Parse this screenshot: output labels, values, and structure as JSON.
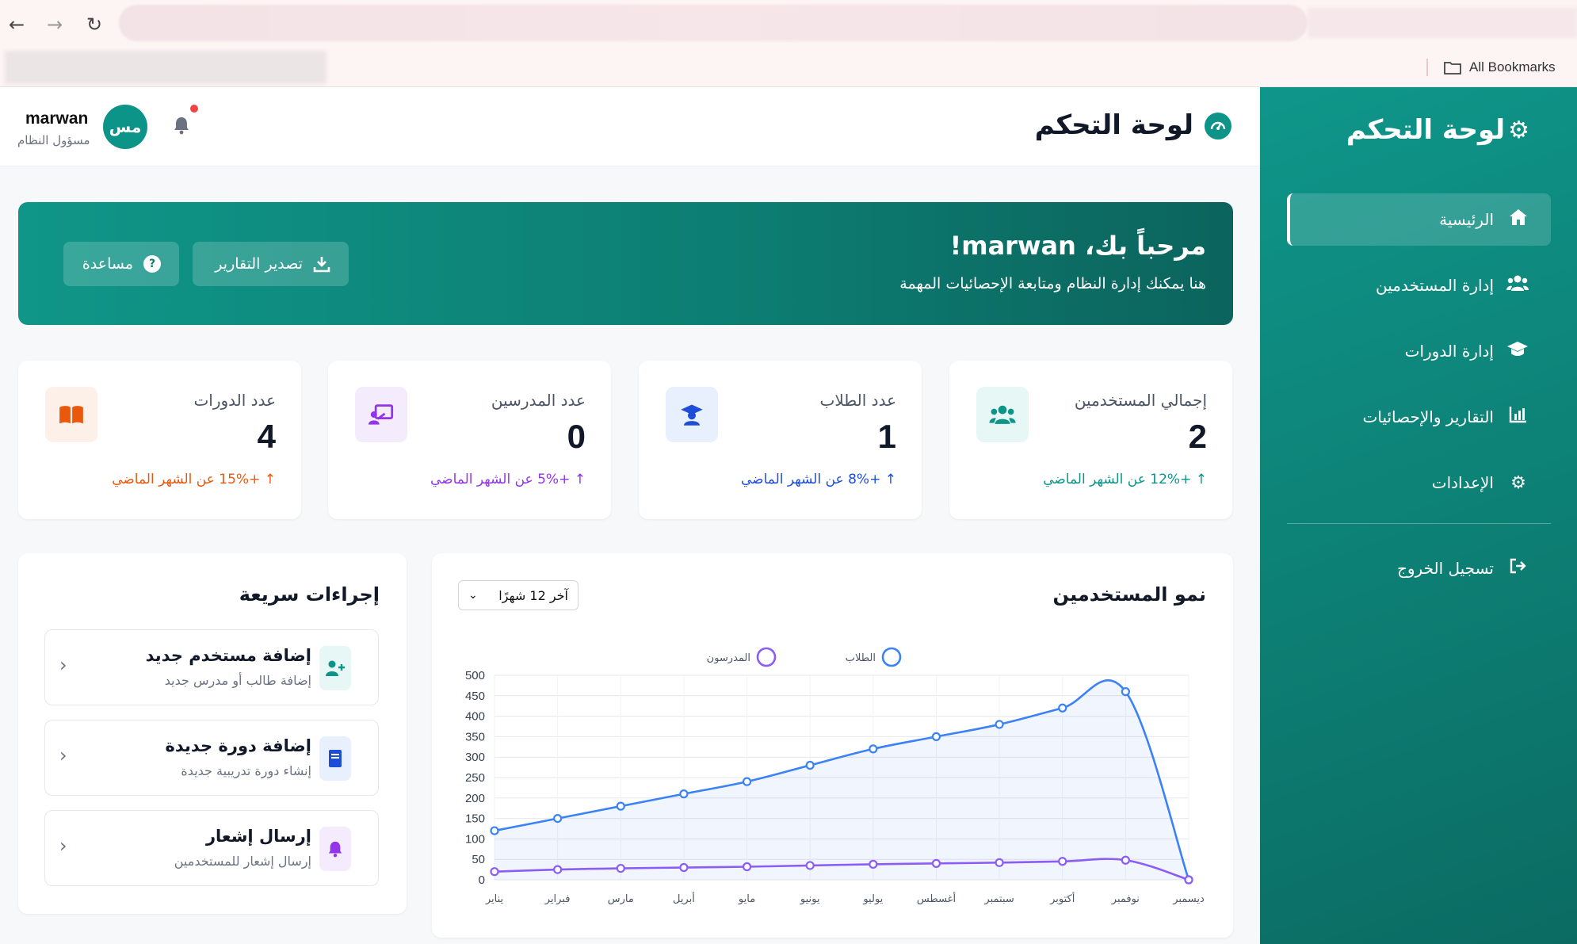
{
  "browser": {
    "bookmarks_label": "All Bookmarks"
  },
  "sidebar": {
    "brand": "لوحة التحكم",
    "items": [
      {
        "label": "الرئيسية",
        "icon": "home-icon",
        "active": true
      },
      {
        "label": "إدارة المستخدمين",
        "icon": "users-icon",
        "active": false
      },
      {
        "label": "إدارة الدورات",
        "icon": "graduation-cap-icon",
        "active": false
      },
      {
        "label": "التقارير والإحصائيات",
        "icon": "chart-icon",
        "active": false
      },
      {
        "label": "الإعدادات",
        "icon": "gear-icon",
        "active": false
      }
    ],
    "logout_label": "تسجيل الخروج"
  },
  "header": {
    "title": "لوحة التحكم",
    "user_name": "marwan",
    "user_role": "مسؤول النظام",
    "avatar_initials": "مس"
  },
  "banner": {
    "title": "مرحباً بك، marwan!",
    "subtitle": "هنا يمكنك إدارة النظام ومتابعة الإحصائيات المهمة",
    "export_label": "تصدير التقارير",
    "help_label": "مساعدة"
  },
  "stats": [
    {
      "label": "إجمالي المستخدمين",
      "value": "2",
      "trend": "↑ +12% عن الشهر الماضي",
      "color": "#0d9488",
      "bg": "#e6f7f5",
      "icon": "users-icon"
    },
    {
      "label": "عدد الطلاب",
      "value": "1",
      "trend": "↑ +8% عن الشهر الماضي",
      "color": "#1d4ed8",
      "bg": "#e8effd",
      "icon": "student-icon"
    },
    {
      "label": "عدد المدرسين",
      "value": "0",
      "trend": "↑ +5% عن الشهر الماضي",
      "color": "#9333ea",
      "bg": "#f4ebfd",
      "icon": "teacher-icon"
    },
    {
      "label": "عدد الدورات",
      "value": "4",
      "trend": "↑ +15% عن الشهر الماضي",
      "color": "#ea580c",
      "bg": "#fdf0e8",
      "icon": "book-icon"
    }
  ],
  "quick_actions": {
    "title": "إجراءات سريعة",
    "items": [
      {
        "title": "إضافة مستخدم جديد",
        "subtitle": "إضافة طالب أو مدرس جديد",
        "icon": "user-plus-icon",
        "color": "#0d9488",
        "bg": "#e6f7f5"
      },
      {
        "title": "إضافة دورة جديدة",
        "subtitle": "إنشاء دورة تدريبية جديدة",
        "icon": "book-icon",
        "color": "#1d4ed8",
        "bg": "#e8effd"
      },
      {
        "title": "إرسال إشعار",
        "subtitle": "إرسال إشعار للمستخدمين",
        "icon": "bell-icon",
        "color": "#9333ea",
        "bg": "#f4ebfd"
      }
    ]
  },
  "growth": {
    "title": "نمو المستخدمين",
    "range_selected": "آخر 12 شهرًا"
  },
  "chart_data": {
    "type": "line",
    "title": "",
    "xlabel": "",
    "ylabel": "",
    "categories": [
      "يناير",
      "فبراير",
      "مارس",
      "أبريل",
      "مايو",
      "يونيو",
      "يوليو",
      "أغسطس",
      "سبتمبر",
      "أكتوبر",
      "نوفمبر",
      "ديسمبر"
    ],
    "ylim": [
      0,
      500
    ],
    "yticks": [
      0,
      50,
      100,
      150,
      200,
      250,
      300,
      350,
      400,
      450,
      500
    ],
    "grid": true,
    "legend_position": "top-center",
    "series": [
      {
        "name": "الطلاب",
        "color": "#3b82f6",
        "fill": true,
        "values": [
          120,
          150,
          180,
          210,
          240,
          280,
          320,
          350,
          380,
          420,
          460,
          0
        ]
      },
      {
        "name": "المدرسون",
        "color": "#8b5cf6",
        "fill": false,
        "values": [
          20,
          25,
          28,
          30,
          32,
          35,
          38,
          40,
          42,
          45,
          48,
          0
        ]
      }
    ]
  }
}
